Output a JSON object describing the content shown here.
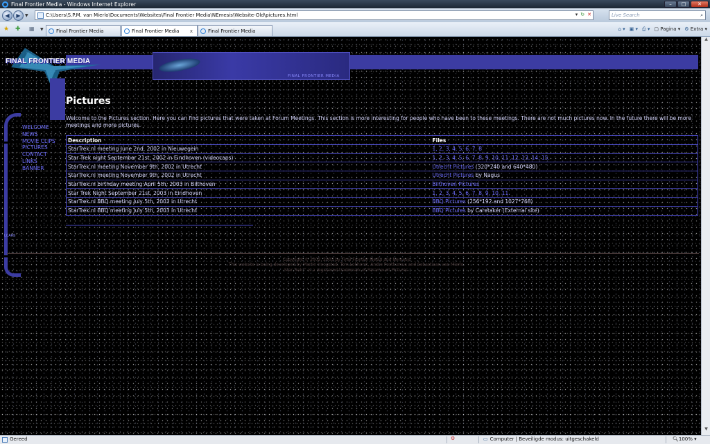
{
  "window": {
    "title": "Final Frontier Media - Windows Internet Explorer"
  },
  "address_bar": {
    "url": "C:\\Users\\S.P.M. van Mierlo\\Documents\\Websites\\Final Frontier Media\\NEmesis\\Website-Old\\pictures.html",
    "search_placeholder": "Live Search"
  },
  "tabs": [
    {
      "label": "Final Frontier Media",
      "active": false
    },
    {
      "label": "Final Frontier Media",
      "active": true
    },
    {
      "label": "Final Frontier Media",
      "active": false
    }
  ],
  "command_bar": {
    "page_label": "Pagina",
    "extra_label": "Extra"
  },
  "site": {
    "logo_text": "FINAL FRONTIER MEDIA",
    "banner_caption": "FINAL FRONTIER MEDIA",
    "nav_label": "LCARS",
    "nav": [
      "WELCOME",
      "NEWS",
      "MOVIE CLIPS",
      "PICTURES",
      "CONTACT",
      "LINKS",
      "BANNER"
    ]
  },
  "content": {
    "title": "Pictures",
    "intro": "Welcome to the Pictures section. Here you can find pictures that were taken at Forum Meetings. This section is more interesting for people who have been to these meetings. There are not much pictures now. In the future there will be more meetings and more pictures.",
    "table": {
      "headers": [
        "Description",
        "Files"
      ],
      "rows": [
        {
          "description": "StarTrek.nl meeting June 2nd, 2002 in Nieuwegein",
          "files": "1, 2, 3, 4, 5, 6, 7, 8",
          "extra": ""
        },
        {
          "description": "Star Trek night September 21st, 2002 in Eindhoven (videocaps)",
          "files": "1, 2, 3, 4, 5, 6, 7, 8, 9, 10, 11 ,12, 13, 14, 15.",
          "extra": ""
        },
        {
          "description": "StarTrek.nl meeting November 9th, 2002 in Utrecht",
          "files": "Utrecht Pictures",
          "extra": "(320*240 and 640*480)"
        },
        {
          "description": "StarTrek.nl meeting November 9th, 2002 in Utrecht",
          "files": "Utrecht Pictures",
          "extra": "by Nagus"
        },
        {
          "description": "StarTrek.nl birthday meeting April 5th, 2003 in Bilthoven",
          "files": "Bilthoven Pictures",
          "extra": ""
        },
        {
          "description": "Star Trek Night September 21st, 2003 in Eindhoven",
          "files": "1, 2, 3, 4, 5, 6, 7, 8, 9, 10, 11.",
          "extra": ""
        },
        {
          "description": "StarTrek.nl BBQ meeting July 5th, 2003 in Utrecht",
          "files": "BBQ Pictures",
          "extra": "(256*192 and 1027*768)"
        },
        {
          "description": "StarTrek.nl BBQ meeting July 5th, 2003 in Utrecht",
          "files": "BBQ Pictures",
          "extra": "by Caretaker (External site)"
        }
      ]
    },
    "footer": [
      "Copyright © 2002, 2003 by Final Frontier Media and Nemesis",
      "This website is being developed by Martin Hoogstad, Tom Lokhorst, Andre Posthumus and Sebastiaan van Mierlo.",
      "Star Trek™ is a registered trademark of Paramount Pictures."
    ]
  },
  "statusbar": {
    "status": "Gereed",
    "zone": "Computer | Beveiligde modus: uitgeschakeld",
    "zoom": "100%"
  },
  "colors": {
    "lcars_blue": "#3c3ca2",
    "link": "#6e6eff",
    "text": "#d8d8ff"
  }
}
